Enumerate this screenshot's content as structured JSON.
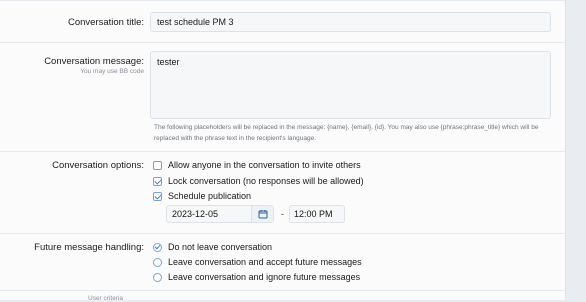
{
  "form": {
    "title": {
      "label": "Conversation title:",
      "value": "test schedule PM 3"
    },
    "message": {
      "label": "Conversation message:",
      "hint": "You may use BB code",
      "value": "tester",
      "explain": "The following placeholders will be replaced in the message: {name}, {email}, {id}. You may also use {phrase:phrase_title} which will be replaced with the phrase text in the recipient's language."
    },
    "options": {
      "label": "Conversation options:",
      "items": [
        {
          "label": "Allow anyone in the conversation to invite others",
          "checked": false
        },
        {
          "label": "Lock conversation (no responses will be allowed)",
          "checked": true
        },
        {
          "label": "Schedule publication",
          "checked": true
        }
      ],
      "date": "2023-12-05",
      "dash": "-",
      "time": "12:00 PM"
    },
    "future": {
      "label": "Future message handling:",
      "items": [
        {
          "label": "Do not leave conversation",
          "checked": true
        },
        {
          "label": "Leave conversation and accept future messages",
          "checked": false
        },
        {
          "label": "Leave conversation and ignore future messages",
          "checked": false
        }
      ]
    },
    "next_hint": "User criteria"
  },
  "icons": {
    "date_picker": "calendar-icon"
  },
  "colors": {
    "accent": "#3d7cc1",
    "panel": "#fbfbfc",
    "input_bg": "#f6f7f9"
  }
}
